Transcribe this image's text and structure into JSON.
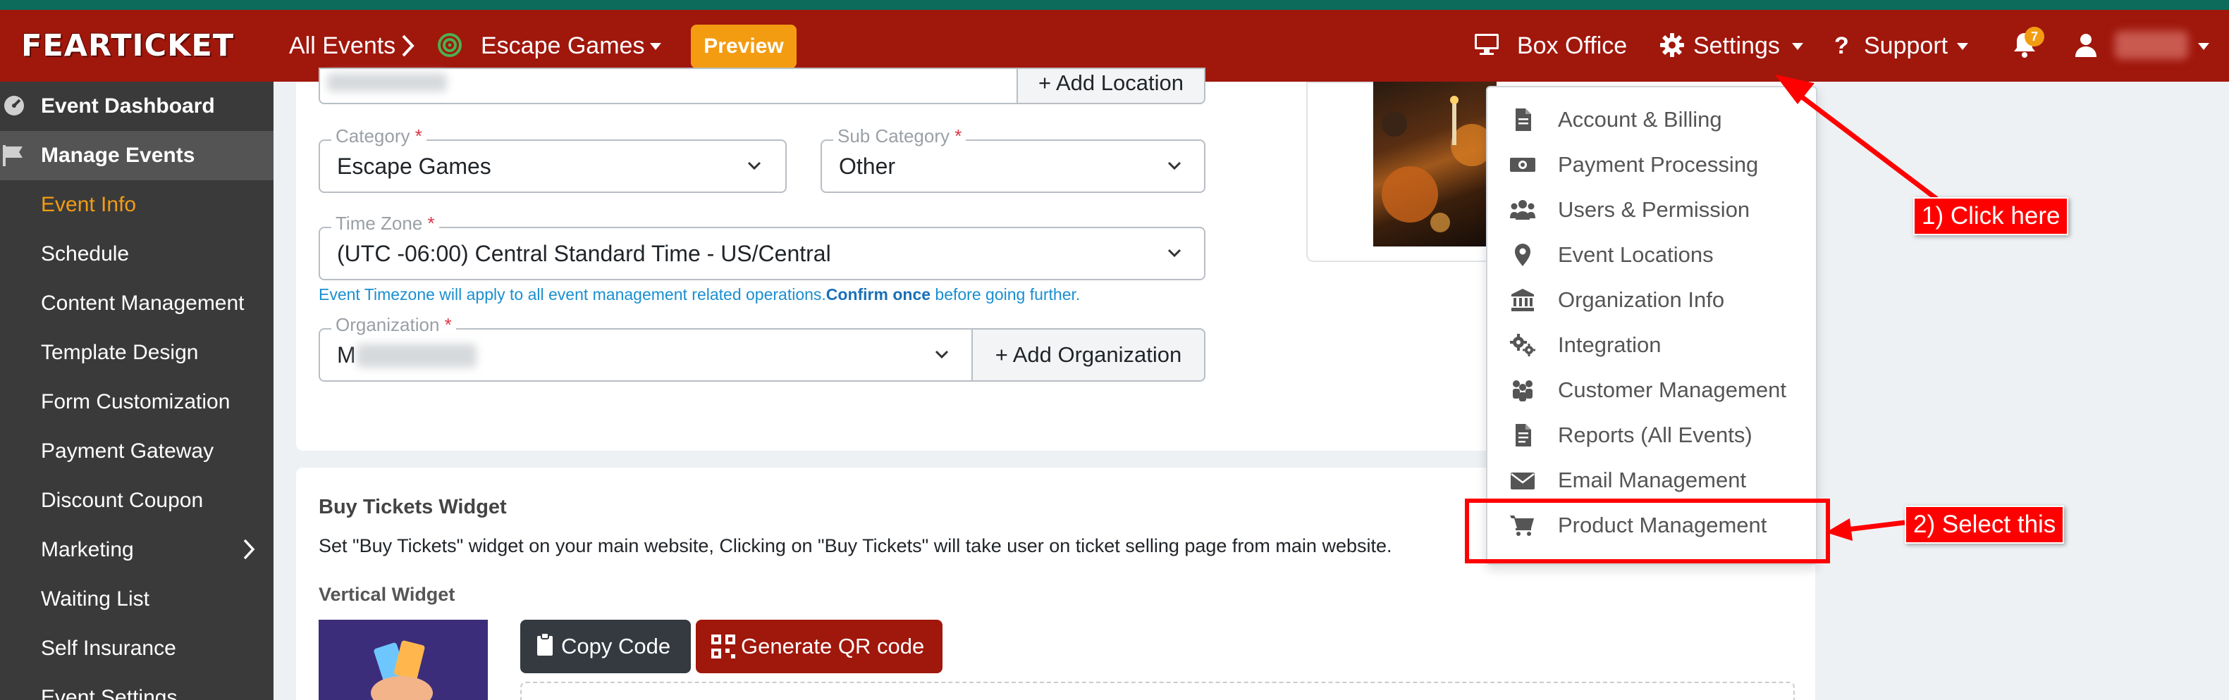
{
  "navbar": {
    "logo_text": "FEARTICKET",
    "all_events": "All Events",
    "event_name": "Escape Games",
    "preview": "Preview",
    "box_office": "Box Office",
    "settings": "Settings",
    "support": "Support",
    "notification_count": "7"
  },
  "sidebar": {
    "items": [
      {
        "label": "Event Dashboard",
        "icon": "dashboard-icon"
      },
      {
        "label": "Manage Events",
        "icon": "flag-icon"
      },
      {
        "label": "Event Info"
      },
      {
        "label": "Schedule"
      },
      {
        "label": "Content Management"
      },
      {
        "label": "Template Design"
      },
      {
        "label": "Form Customization"
      },
      {
        "label": "Payment Gateway"
      },
      {
        "label": "Discount Coupon"
      },
      {
        "label": "Marketing"
      },
      {
        "label": "Waiting List"
      },
      {
        "label": "Self Insurance"
      },
      {
        "label": "Event Settings"
      }
    ]
  },
  "form": {
    "add_location": "+ Add Location",
    "category_label": "Category",
    "category_value": "Escape Games",
    "subcategory_label": "Sub Category",
    "subcategory_value": "Other",
    "timezone_label": "Time Zone",
    "timezone_value": "(UTC -06:00) Central Standard Time - US/Central",
    "timezone_help_1": "Event Timezone will apply to all event management related operations.",
    "timezone_help_2": "Confirm once",
    "timezone_help_3": " before going further.",
    "organization_label": "Organization",
    "organization_value": "M",
    "add_organization": "+ Add Organization",
    "required_mark": "*"
  },
  "widget": {
    "title": "Buy Tickets Widget",
    "description": "Set \"Buy Tickets\" widget on your main website, Clicking on \"Buy Tickets\" will take user on ticket selling page from main website.",
    "vertical_label": "Vertical Widget",
    "copy_code": "Copy Code",
    "generate_qr": "Generate QR code"
  },
  "settings_menu": {
    "items": [
      {
        "label": "Account & Billing",
        "icon": "file-icon"
      },
      {
        "label": "Payment Processing",
        "icon": "money-icon"
      },
      {
        "label": "Users & Permission",
        "icon": "users-icon"
      },
      {
        "label": "Event Locations",
        "icon": "map-marker-icon"
      },
      {
        "label": "Organization Info",
        "icon": "bank-icon"
      },
      {
        "label": "Integration",
        "icon": "cogs-icon"
      },
      {
        "label": "Customer Management",
        "icon": "people-icon"
      },
      {
        "label": "Reports (All Events)",
        "icon": "report-icon"
      },
      {
        "label": "Email Management",
        "icon": "envelope-icon"
      },
      {
        "label": "Product Management",
        "icon": "cart-icon"
      }
    ]
  },
  "annotations": {
    "step1": "1) Click here",
    "step2": "2) Select this"
  }
}
